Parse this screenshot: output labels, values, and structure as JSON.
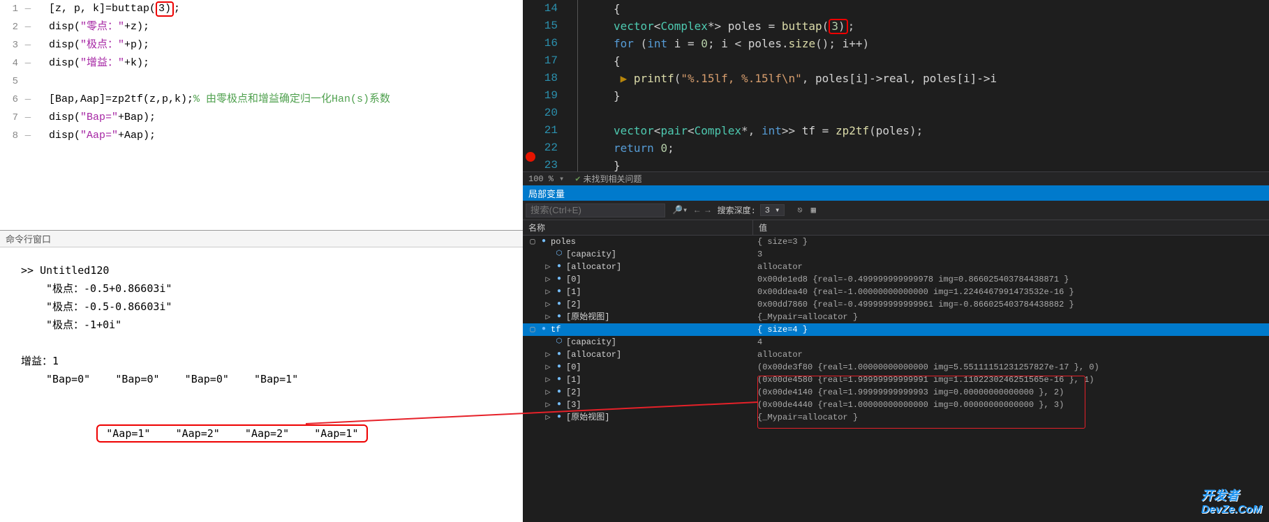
{
  "left_editor": {
    "lines": [
      {
        "num": "1",
        "prefix": "[z, p, k]=buttap(",
        "highlight": "3)",
        "suffix": ";"
      },
      {
        "num": "2",
        "prefix": "disp(",
        "str": "\"零点：\"",
        "suffix": "+z);"
      },
      {
        "num": "3",
        "prefix": "disp(",
        "str": "\"极点：\"",
        "suffix": "+p);"
      },
      {
        "num": "4",
        "prefix": "disp(",
        "str": "\"增益：\"",
        "suffix": "+k);"
      },
      {
        "num": "5",
        "blank": true
      },
      {
        "num": "6",
        "prefix": "[Bap,Aap]=zp2tf(z,p,k);",
        "comment": "% 由零极点和增益确定归一化Han(s)系数"
      },
      {
        "num": "7",
        "prefix": "disp(",
        "str": "\"Bap=\"",
        "suffix": "+Bap);"
      },
      {
        "num": "8",
        "prefix": "disp(",
        "str": "\"Aap=\"",
        "suffix": "+Aap);"
      }
    ]
  },
  "cmd_window": {
    "title": "命令行窗口",
    "prompt": ">> Untitled120",
    "out": [
      "\"极点：-0.5+0.86603i\"",
      "\"极点：-0.5-0.86603i\"",
      "\"极点：-1+0i\""
    ],
    "gain": "增益：1",
    "bap": "\"Bap=0\"    \"Bap=0\"    \"Bap=0\"    \"Bap=1\"",
    "aap": "\"Aap=1\"    \"Aap=2\"    \"Aap=2\"    \"Aap=1\""
  },
  "vs_editor": {
    "lines": [
      {
        "num": "14",
        "text": "{"
      },
      {
        "num": "15",
        "code": "vector<Complex*> poles = buttap(3);",
        "highlight3": true
      },
      {
        "num": "16",
        "code": "for (int i = 0; i < poles.size(); i++)"
      },
      {
        "num": "17",
        "code": "{"
      },
      {
        "num": "18",
        "code": "  printf(\"%.15lf, %.15lf\\n\", poles[i]->real, poles[i]->i"
      },
      {
        "num": "19",
        "code": "}"
      },
      {
        "num": "20",
        "blank": true
      },
      {
        "num": "21",
        "code": "vector<pair<Complex*, int>> tf = zp2tf(poles);"
      },
      {
        "num": "22",
        "code": "return 0;"
      },
      {
        "num": "23",
        "code": "}"
      }
    ]
  },
  "status": {
    "zoom": "100 %",
    "msg": "未找到相关问题"
  },
  "locals": {
    "header": "局部变量",
    "search_placeholder": "搜索(Ctrl+E)",
    "depth_label": "搜索深度:",
    "depth_value": "3",
    "col_name": "名称",
    "col_value": "值",
    "rows": [
      {
        "depth": 0,
        "exp": "▢",
        "icon": "●",
        "name": "poles",
        "value": "{ size=3 }"
      },
      {
        "depth": 1,
        "exp": "",
        "icon": "⬡",
        "name": "[capacity]",
        "value": "3"
      },
      {
        "depth": 1,
        "exp": "▷",
        "icon": "●",
        "name": "[allocator]",
        "value": "allocator"
      },
      {
        "depth": 1,
        "exp": "▷",
        "icon": "●",
        "name": "[0]",
        "value": "0x00de1ed8 {real=-0.499999999999978 img=0.866025403784438871 }"
      },
      {
        "depth": 1,
        "exp": "▷",
        "icon": "●",
        "name": "[1]",
        "value": "0x00ddea40 {real=-1.00000000000000 img=1.2246467991473532e-16 }"
      },
      {
        "depth": 1,
        "exp": "▷",
        "icon": "●",
        "name": "[2]",
        "value": "0x00dd7860 {real=-0.499999999999961 img=-0.866025403784438882 }"
      },
      {
        "depth": 1,
        "exp": "▷",
        "icon": "●",
        "name": "[原始视图]",
        "value": "{_Mypair=allocator }"
      },
      {
        "depth": 0,
        "exp": "▢",
        "icon": "●",
        "name": "tf",
        "value": "{ size=4 }",
        "selected": true
      },
      {
        "depth": 1,
        "exp": "",
        "icon": "⬡",
        "name": "[capacity]",
        "value": "4"
      },
      {
        "depth": 1,
        "exp": "▷",
        "icon": "●",
        "name": "[allocator]",
        "value": "allocator"
      },
      {
        "depth": 1,
        "exp": "▷",
        "icon": "●",
        "name": "[0]",
        "value": "(0x00de3f80 {real=1.00000000000000 img=5.55111151231257827e-17 }, 0)"
      },
      {
        "depth": 1,
        "exp": "▷",
        "icon": "●",
        "name": "[1]",
        "value": "(0x00de4580 {real=1.99999999999991 img=1.1102230246251565e-16 }, 1)"
      },
      {
        "depth": 1,
        "exp": "▷",
        "icon": "●",
        "name": "[2]",
        "value": "(0x00de4140 {real=1.99999999999993 img=0.00000000000000 }, 2)"
      },
      {
        "depth": 1,
        "exp": "▷",
        "icon": "●",
        "name": "[3]",
        "value": "(0x00de4440 {real=1.00000000000000 img=0.00000000000000 }, 3)"
      },
      {
        "depth": 1,
        "exp": "▷",
        "icon": "●",
        "name": "[原始视图]",
        "value": "{_Mypair=allocator }"
      }
    ]
  },
  "watermark": {
    "line1": "开发者",
    "line2": "DevZe.CoM"
  }
}
